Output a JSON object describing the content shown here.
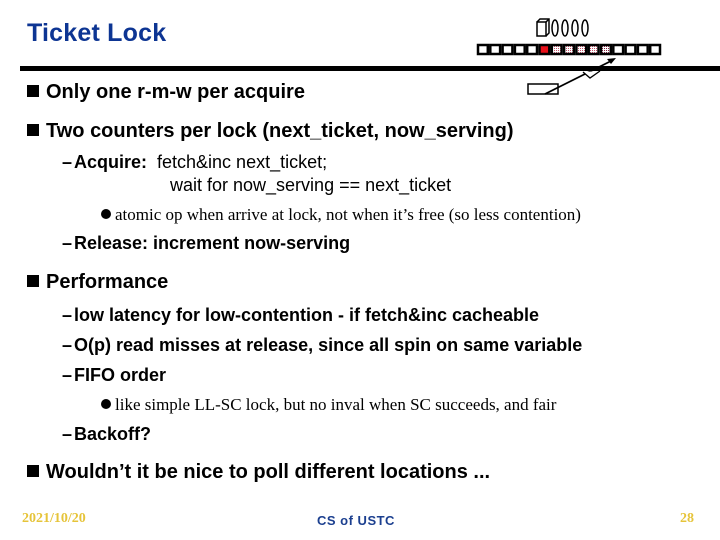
{
  "slide": {
    "title": "Ticket Lock",
    "diagram": {
      "label": "ticket queue illustration",
      "ticket_count": 4,
      "slots": [
        "empty",
        "empty",
        "empty",
        "empty",
        "empty",
        "serving",
        "waiting",
        "waiting",
        "waiting",
        "waiting",
        "next",
        "empty",
        "empty",
        "empty",
        "empty"
      ],
      "colors": {
        "serving": "#e8101a",
        "waiting": "#f0c8d0",
        "next": "#c07890",
        "empty": "#ffffff",
        "border": "#000000"
      }
    },
    "bullets": [
      {
        "id": "b1",
        "text": "Only one r-m-w per acquire"
      },
      {
        "id": "b2",
        "text": "Two counters per lock (next_ticket, now_serving)",
        "sub": [
          {
            "label": "Acquire:",
            "text": "fetch&inc next_ticket;",
            "cont": "wait for now_serving == next_ticket",
            "note": "atomic op when arrive at lock, not when it’s free (so less contention)"
          },
          {
            "label": "Release: increment now-serving"
          }
        ]
      },
      {
        "id": "b3",
        "text": "Performance",
        "sub": [
          {
            "label": "low latency for low-contention -  if fetch&inc cacheable"
          },
          {
            "label": "O(p) read misses at release, since all spin on same variable"
          },
          {
            "label": "FIFO order",
            "note": "like simple LL-SC lock, but no inval when SC succeeds, and fair"
          },
          {
            "label": "Backoff?"
          }
        ]
      },
      {
        "id": "b4",
        "text": "Wouldn’t it be nice to poll different locations ..."
      }
    ]
  },
  "footer": {
    "date": "2021/10/20",
    "center": "CS of USTC",
    "page": "28"
  }
}
